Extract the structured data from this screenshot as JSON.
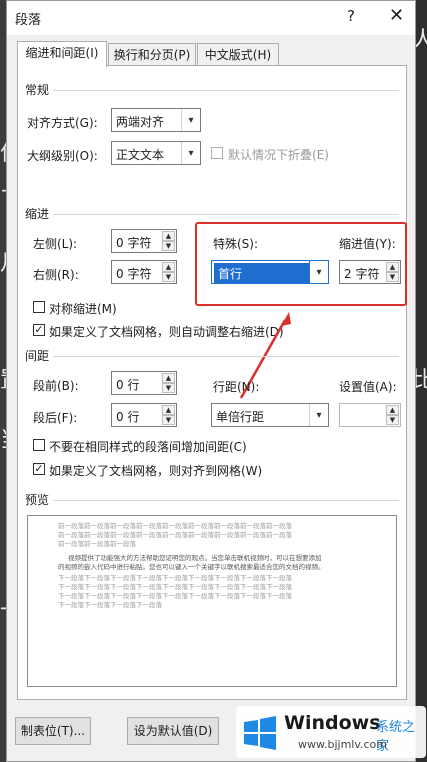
{
  "dialog": {
    "title": "段落",
    "help": "?",
    "close": "✕"
  },
  "tabs": [
    {
      "label": "缩进和间距(I)",
      "active": true
    },
    {
      "label": "换行和分页(P)",
      "active": false
    },
    {
      "label": "中文版式(H)",
      "active": false
    }
  ],
  "general": {
    "section": "常规",
    "alignment_label": "对齐方式(G):",
    "alignment_value": "两端对齐",
    "outline_label": "大纲级别(O):",
    "outline_value": "正文文本",
    "collapse_label": "默认情况下折叠(E)"
  },
  "indent": {
    "section": "缩进",
    "left_label": "左侧(L):",
    "left_value": "0 字符",
    "right_label": "右侧(R):",
    "right_value": "0 字符",
    "special_label": "特殊(S):",
    "special_value": "首行",
    "indent_by_label": "缩进值(Y):",
    "indent_by_value": "2 字符",
    "mirror_label": "对称缩进(M)",
    "mirror_checked": false,
    "auto_adjust_label": "如果定义了文档网格，则自动调整右缩进(D)",
    "auto_adjust_checked": true
  },
  "spacing": {
    "section": "间距",
    "before_label": "段前(B):",
    "before_value": "0 行",
    "after_label": "段后(F):",
    "after_value": "0 行",
    "line_spacing_label": "行距(N):",
    "line_spacing_value": "单倍行距",
    "at_label": "设置值(A):",
    "at_value": "",
    "no_space_label": "不要在相同样式的段落间增加间距(C)",
    "no_space_checked": false,
    "snap_grid_label": "如果定义了文档网格，则对齐到网格(W)",
    "snap_grid_checked": true
  },
  "preview": {
    "section": "预览",
    "prev_line1": "前一段落前一段落前一段落前一段落前一段落前一段落前一段落前一段落前一段落",
    "prev_line2": "前一段落前一段落前一段落前一段落前一段落前一段落前一段落前一段落前一段落",
    "prev_line3": "前一段落前一段落前一段落",
    "body_line1": "视频提供了功能强大的方法帮助您证明您的观点。当您单击联机视频时，可以在想要添加",
    "body_line2": "的视频的嵌入代码中进行粘贴。您也可以键入一个关键字以联机搜索最适合您的文档的视频。",
    "next_line1": "下一段落下一段落下一段落下一段落下一段落下一段落下一段落下一段落下一段落",
    "next_line2": "下一段落下一段落下一段落下一段落下一段落下一段落下一段落下一段落下一段落",
    "next_line3": "下一段落下一段落下一段落下一段落下一段落下一段落下一段落下一段落下一段落",
    "next_line4": "下一段落下一段落下一段落下一段落"
  },
  "buttons": {
    "tabs": "制表位(T)...",
    "set_default": "设为默认值(D)"
  },
  "watermark": {
    "brand": "Windows",
    "site_cn": "系统之家",
    "url": "www.bjjmlv.com"
  },
  "background_doc": {
    "chars": [
      "作",
      "了",
      "月",
      "人",
      "置",
      "当",
      "比",
      "一"
    ]
  },
  "colors": {
    "highlight_red": "#d9302b",
    "selected_blue": "#1e6fd0"
  }
}
